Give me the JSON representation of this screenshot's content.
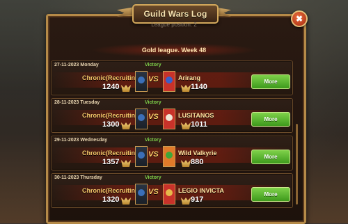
{
  "window": {
    "title": "Guild Wars Log",
    "subtitle": "League position: 2",
    "league_header": "Gold league. Week 48",
    "close_label": "✖"
  },
  "colors": {
    "victory": "#7ed24a",
    "more_button": "#5cb532",
    "frame_gold": "#b58a48"
  },
  "entries": [
    {
      "date": "27-11-2023  Monday",
      "result": "Victory",
      "own_guild": "Chronic(Recruiting)",
      "own_score": "1240",
      "vs": "VS",
      "opponent": "Arirang",
      "opponent_score": "1140",
      "opponent_banner_color": "#c8322a",
      "opponent_emblem_color": "#3a5fc8",
      "more_label": "More"
    },
    {
      "date": "28-11-2023  Tuesday",
      "result": "Victory",
      "own_guild": "Chronic(Recruiting)",
      "own_score": "1300",
      "vs": "VS",
      "opponent": "LUSITANOS",
      "opponent_score": "1011",
      "opponent_banner_color": "#c8322a",
      "opponent_emblem_color": "#f0e6d6",
      "more_label": "More"
    },
    {
      "date": "29-11-2023  Wednesday",
      "result": "Victory",
      "own_guild": "Chronic(Recruiting)",
      "own_score": "1357",
      "vs": "VS",
      "opponent": "Wild Valkyrie",
      "opponent_score": "880",
      "opponent_banner_color": "#e07a2a",
      "opponent_emblem_color": "#3fa63a",
      "more_label": "More"
    },
    {
      "date": "30-11-2023  Thursday",
      "result": "Victory",
      "own_guild": "Chronic(Recruiting)",
      "own_score": "1320",
      "vs": "VS",
      "opponent": "LEGIO INVICTA",
      "opponent_score": "917",
      "opponent_banner_color": "#c8322a",
      "opponent_emblem_color": "#e8b84a",
      "more_label": "More"
    }
  ]
}
